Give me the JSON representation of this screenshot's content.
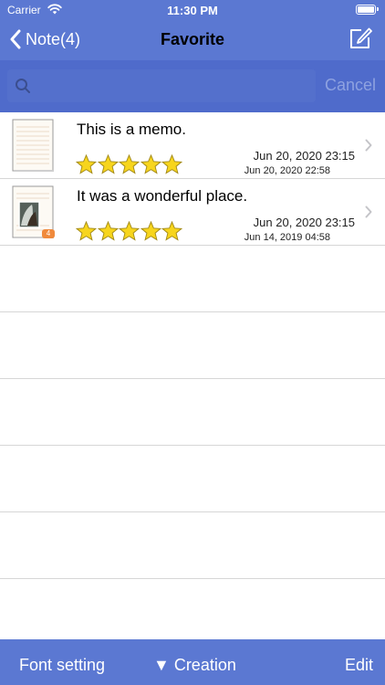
{
  "status_bar": {
    "carrier": "Carrier",
    "time": "11:30 PM"
  },
  "nav": {
    "back_label": "Note(4)",
    "title": "Favorite"
  },
  "search": {
    "placeholder": "",
    "cancel_label": "Cancel"
  },
  "notes": [
    {
      "title": "This is a memo.",
      "rating": 5,
      "updated": "Jun 20, 2020 23:15",
      "created": "Jun 20, 2020 22:58",
      "attachment_badge": ""
    },
    {
      "title": "It was a wonderful place.",
      "rating": 5,
      "updated": "Jun 20, 2020 23:15",
      "created": "Jun 14, 2019 04:58",
      "attachment_badge": "4"
    }
  ],
  "toolbar": {
    "font_setting": "Font setting",
    "sort": "▼ Creation",
    "edit": "Edit"
  },
  "colors": {
    "bar": "#5b78d2",
    "search_bg": "#4f6bcb",
    "star": "#f7d51d"
  },
  "icons": {
    "back": "chevron-left-icon",
    "compose": "compose-icon",
    "search": "search-icon",
    "disclosure": "chevron-right-icon"
  }
}
